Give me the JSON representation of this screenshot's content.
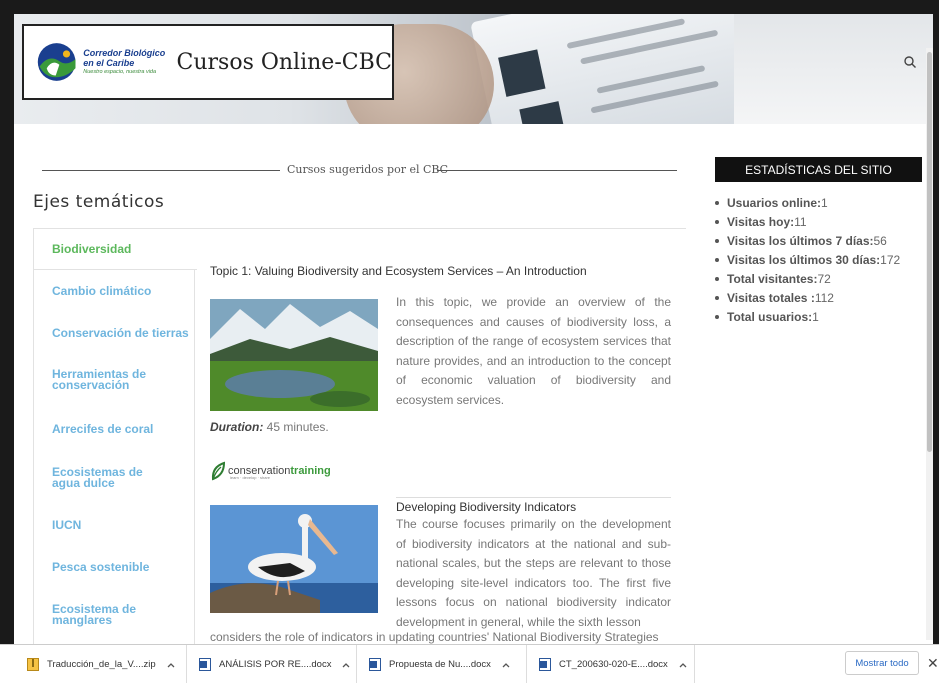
{
  "header": {
    "logo_line1": "Corredor Biológico",
    "logo_line2": "en el Caribe",
    "logo_tagline": "Nuestro espacio, nuestra vida",
    "site_title": "Cursos Online-CBC",
    "search_icon": "search-icon"
  },
  "section": {
    "label": "Cursos sugeridos por el CBC",
    "heading": "Ejes temáticos"
  },
  "sidebar": {
    "items": [
      {
        "label": "Biodiversidad",
        "active": true
      },
      {
        "label": "Cambio climático",
        "active": false
      },
      {
        "label": "Conservación de tierras",
        "active": false
      },
      {
        "label": "Herramientas de conservación",
        "active": false
      },
      {
        "label": "Arrecifes de coral",
        "active": false
      },
      {
        "label": "Ecosistemas de agua dulce",
        "active": false
      },
      {
        "label": "IUCN",
        "active": false
      },
      {
        "label": "Pesca sostenible",
        "active": false
      },
      {
        "label": "Ecosistema de manglares",
        "active": false
      }
    ]
  },
  "courses": [
    {
      "title": "Topic 1: Valuing Biodiversity and Ecosystem Services – An Introduction",
      "description": "In this topic, we provide an overview of the consequences and causes of biodiversity loss, a description of the range of ecosystem services that nature provides, and an introduction to the concept of economic valuation of biodiversity and ecosystem services.",
      "duration_label": "Duration:",
      "duration_value": "45 minutes.",
      "provider": "conservationtraining",
      "provider_part1": "conservation",
      "provider_part2": "training",
      "provider_sub": "learn · develop · share"
    },
    {
      "title": "Developing Biodiversity Indicators",
      "description": "The course focuses primarily on the development of biodiversity indicators at the national and sub-national scales, but the steps are relevant to those developing site-level indicators too. The first five lessons focus on national biodiversity indicator development in general, while the sixth lesson",
      "description_cont": "considers the role of indicators in updating countries' National Biodiversity Strategies"
    }
  ],
  "stats": {
    "heading": "ESTADÍSTICAS DEL SITIO",
    "items": [
      {
        "key": "Usuarios online:",
        "value": "1"
      },
      {
        "key": "Visitas hoy:",
        "value": "11"
      },
      {
        "key": "Visitas los últimos 7 días:",
        "value": "56"
      },
      {
        "key": "Visitas los últimos 30 días:",
        "value": "172"
      },
      {
        "key": "Total visitantes:",
        "value": "72"
      },
      {
        "key": "Visitas totales :",
        "value": "112"
      },
      {
        "key": "Total usuarios:",
        "value": "1"
      }
    ]
  },
  "downloads": {
    "items": [
      {
        "name": "Traducción_de_la_V....zip",
        "type": "zip"
      },
      {
        "name": "ANÁLISIS POR RE....docx",
        "type": "docx"
      },
      {
        "name": "Propuesta de Nu....docx",
        "type": "docx"
      },
      {
        "name": "CT_200630-020-E....docx",
        "type": "docx"
      }
    ],
    "show_all": "Mostrar todo",
    "close": "✕"
  },
  "colors": {
    "nav_link": "#6fb5de",
    "nav_active": "#5cb85c",
    "stats_header_bg": "#111111",
    "download_link": "#2a6ac4"
  }
}
